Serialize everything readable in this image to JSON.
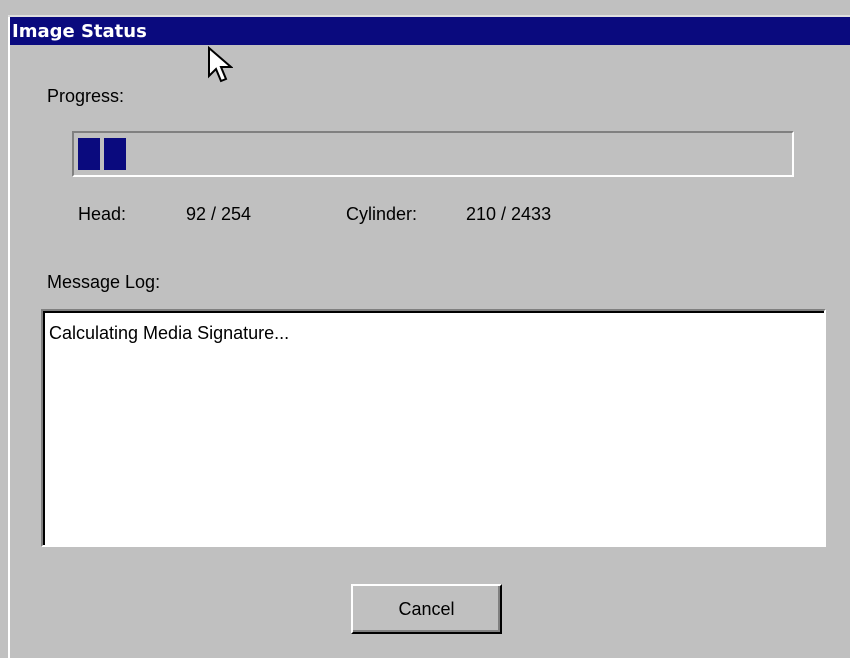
{
  "window": {
    "title": "Image Status"
  },
  "progress": {
    "label": "Progress:",
    "fraction": 0.078,
    "bar_color": "#0a0a7e"
  },
  "geometry": {
    "head_label": "Head:",
    "head_value": "92 /  254",
    "cylinder_label": "Cylinder:",
    "cylinder_value": "210 /  2433"
  },
  "log": {
    "label": "Message Log:",
    "lines": [
      "Calculating Media Signature..."
    ]
  },
  "buttons": {
    "cancel_label": "Cancel"
  },
  "icons": {
    "cursor": "arrow-cursor-icon"
  },
  "colors": {
    "dialog_bg": "#c0c0c0",
    "titlebar_bg": "#0a0a7e",
    "titlebar_text": "#ffffff"
  }
}
